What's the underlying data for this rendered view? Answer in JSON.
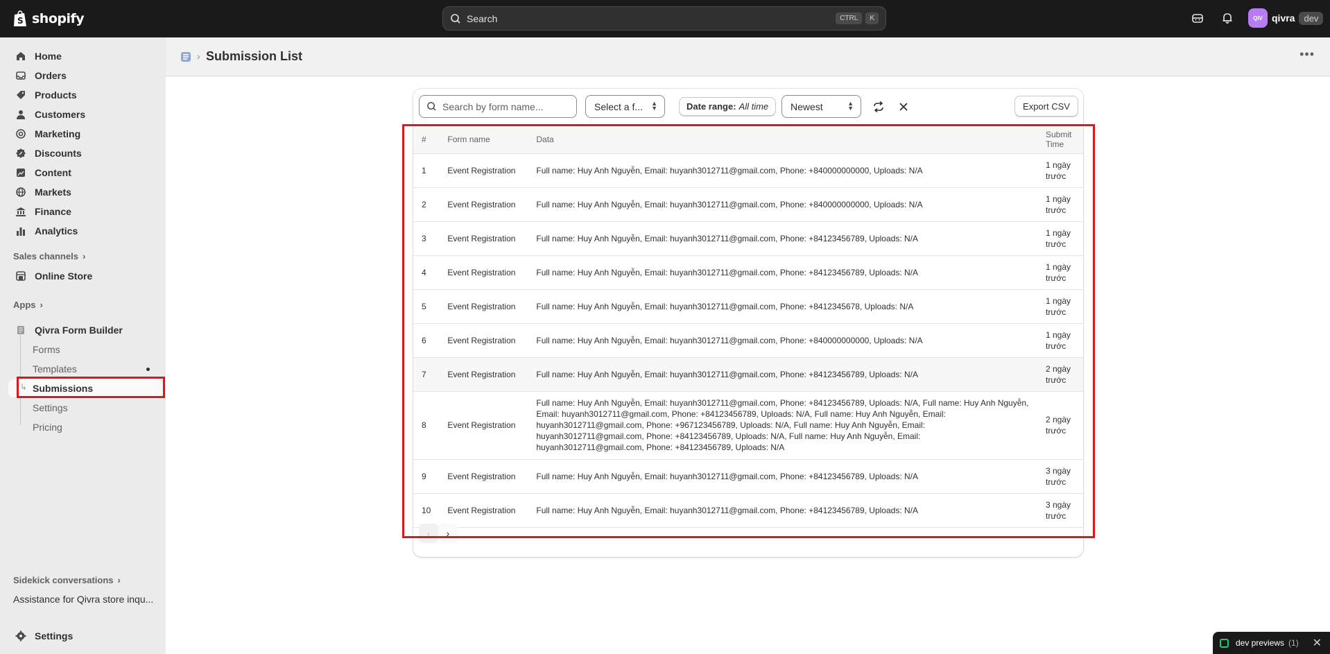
{
  "topbar": {
    "logo_text": "shopify",
    "search_label": "Search",
    "shortcut_ctrl": "CTRL",
    "shortcut_key": "K",
    "avatar_initials": "QIV",
    "store_name": "qivra",
    "store_badge": "dev"
  },
  "sidebar": {
    "nav": [
      {
        "label": "Home",
        "icon": "home-icon"
      },
      {
        "label": "Orders",
        "icon": "inbox-icon"
      },
      {
        "label": "Products",
        "icon": "tag-icon"
      },
      {
        "label": "Customers",
        "icon": "person-icon"
      },
      {
        "label": "Marketing",
        "icon": "target-icon"
      },
      {
        "label": "Discounts",
        "icon": "discount-icon"
      },
      {
        "label": "Content",
        "icon": "content-icon"
      },
      {
        "label": "Markets",
        "icon": "globe-icon"
      },
      {
        "label": "Finance",
        "icon": "bank-icon"
      },
      {
        "label": "Analytics",
        "icon": "bar-chart-icon"
      }
    ],
    "sales_channels_label": "Sales channels",
    "online_store_label": "Online Store",
    "apps_label": "Apps",
    "app_name": "Qivra Form Builder",
    "app_subitems": [
      "Forms",
      "Templates",
      "Submissions",
      "Settings",
      "Pricing"
    ],
    "sidekick_label": "Sidekick conversations",
    "sidekick_item": "Assistance for Qivra store inqu...",
    "settings_label": "Settings"
  },
  "page": {
    "title": "Submission List"
  },
  "filters": {
    "search_placeholder": "Search by form name...",
    "form_select": "Select a f...",
    "date_range_label": "Date range:",
    "date_range_value": "All time",
    "sort_select": "Newest",
    "export_label": "Export CSV"
  },
  "table": {
    "headers": {
      "num": "#",
      "form": "Form name",
      "data": "Data",
      "time": "Submit Time"
    },
    "rows": [
      {
        "num": "1",
        "form": "Event Registration",
        "data": "Full name: Huy Anh Nguyễn, Email: huyanh3012711@gmail.com, Phone: +840000000000, Uploads: N/A",
        "time": "1 ngày trước"
      },
      {
        "num": "2",
        "form": "Event Registration",
        "data": "Full name: Huy Anh Nguyễn, Email: huyanh3012711@gmail.com, Phone: +840000000000, Uploads: N/A",
        "time": "1 ngày trước"
      },
      {
        "num": "3",
        "form": "Event Registration",
        "data": "Full name: Huy Anh Nguyễn, Email: huyanh3012711@gmail.com, Phone: +84123456789, Uploads: N/A",
        "time": "1 ngày trước"
      },
      {
        "num": "4",
        "form": "Event Registration",
        "data": "Full name: Huy Anh Nguyễn, Email: huyanh3012711@gmail.com, Phone: +84123456789, Uploads: N/A",
        "time": "1 ngày trước"
      },
      {
        "num": "5",
        "form": "Event Registration",
        "data": "Full name: Huy Anh Nguyễn, Email: huyanh3012711@gmail.com, Phone: +8412345678, Uploads: N/A",
        "time": "1 ngày trước"
      },
      {
        "num": "6",
        "form": "Event Registration",
        "data": "Full name: Huy Anh Nguyễn, Email: huyanh3012711@gmail.com, Phone: +840000000000, Uploads: N/A",
        "time": "1 ngày trước"
      },
      {
        "num": "7",
        "form": "Event Registration",
        "data": "Full name: Huy Anh Nguyễn, Email: huyanh3012711@gmail.com, Phone: +84123456789, Uploads: N/A",
        "time": "2 ngày trước"
      },
      {
        "num": "8",
        "form": "Event Registration",
        "data": "Full name: Huy Anh Nguyễn, Email: huyanh3012711@gmail.com, Phone: +84123456789, Uploads: N/A, Full name: Huy Anh Nguyễn, Email: huyanh3012711@gmail.com, Phone: +84123456789, Uploads: N/A, Full name: Huy Anh Nguyễn, Email: huyanh3012711@gmail.com, Phone: +967123456789, Uploads: N/A, Full name: Huy Anh Nguyễn, Email: huyanh3012711@gmail.com, Phone: +84123456789, Uploads: N/A, Full name: Huy Anh Nguyễn, Email: huyanh3012711@gmail.com, Phone: +84123456789, Uploads: N/A",
        "time": "2 ngày trước"
      },
      {
        "num": "9",
        "form": "Event Registration",
        "data": "Full name: Huy Anh Nguyễn, Email: huyanh3012711@gmail.com, Phone: +84123456789, Uploads: N/A",
        "time": "3 ngày trước"
      },
      {
        "num": "10",
        "form": "Event Registration",
        "data": "Full name: Huy Anh Nguyễn, Email: huyanh3012711@gmail.com, Phone: +84123456789, Uploads: N/A",
        "time": "3 ngày trước"
      }
    ]
  },
  "pager": {
    "prev": "‹",
    "next": "›"
  },
  "dev_toast": {
    "label": "dev previews",
    "count": "(1)"
  },
  "colors": {
    "highlight": "#e5131b",
    "topbar": "#1a1a1a",
    "avatar": "#b77cf2"
  }
}
